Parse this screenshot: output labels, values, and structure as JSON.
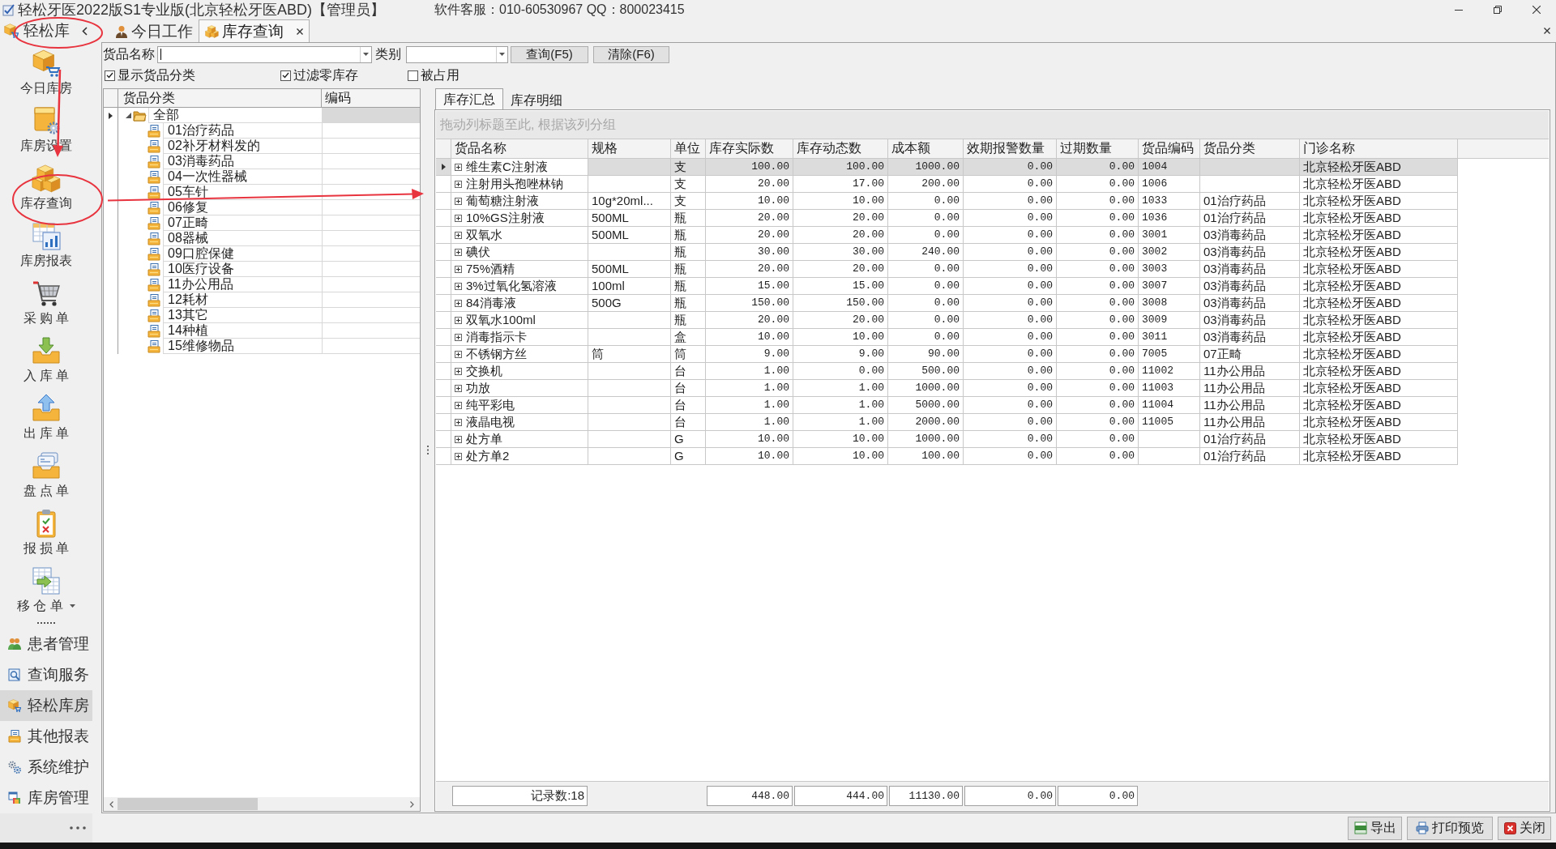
{
  "window": {
    "title": "轻松牙医2022版S1专业版(北京轻松牙医ABD)【管理员】",
    "support": "软件客服：010-60530967 QQ：800023415"
  },
  "sidebar": {
    "title": "轻松库",
    "tools": [
      {
        "label": "今日库房",
        "has_menu": false
      },
      {
        "label": "库房设置",
        "has_menu": false
      },
      {
        "label": "库存查询",
        "has_menu": false
      },
      {
        "label": "库房报表",
        "has_menu": false
      },
      {
        "label": "采 购 单",
        "has_menu": false
      },
      {
        "label": "入 库 单",
        "has_menu": false
      },
      {
        "label": "出 库 单",
        "has_menu": false
      },
      {
        "label": "盘 点 单",
        "has_menu": false
      },
      {
        "label": "报 损 单",
        "has_menu": false
      },
      {
        "label": "移 仓 单",
        "has_menu": true
      }
    ],
    "nav": [
      {
        "label": "患者管理",
        "selected": false
      },
      {
        "label": "查询服务",
        "selected": false
      },
      {
        "label": "轻松库房",
        "selected": true
      },
      {
        "label": "其他报表",
        "selected": false
      },
      {
        "label": "系统维护",
        "selected": false
      },
      {
        "label": "库房管理",
        "selected": false
      }
    ]
  },
  "tabs": [
    {
      "label": "今日工作",
      "selected": false,
      "closable": false
    },
    {
      "label": "库存查询",
      "selected": true,
      "closable": true
    }
  ],
  "filter": {
    "name_label": "货品名称",
    "category_label": "类别",
    "buttons": [
      "查询(F5)",
      "清除(F6)"
    ],
    "options": [
      {
        "label": "显示货品分类",
        "checked": true
      },
      {
        "label": "过滤零库存",
        "checked": true
      },
      {
        "label": "被占用",
        "checked": false
      }
    ]
  },
  "category_tree": {
    "columns": [
      "货品分类",
      "编码"
    ],
    "items": [
      {
        "label": "全部",
        "selected": true,
        "expanded": true,
        "children": [
          {
            "label": "01治疗药品",
            "selected": false
          },
          {
            "label": "02补牙材料发的",
            "selected": false
          },
          {
            "label": "03消毒药品",
            "selected": false
          },
          {
            "label": "04一次性器械",
            "selected": false
          },
          {
            "label": "05车针",
            "selected": false
          },
          {
            "label": "06修复",
            "selected": false
          },
          {
            "label": "07正畸",
            "selected": false
          },
          {
            "label": "08器械",
            "selected": false
          },
          {
            "label": "09口腔保健",
            "selected": false
          },
          {
            "label": "10医疗设备",
            "selected": false
          },
          {
            "label": "11办公用品",
            "selected": false
          },
          {
            "label": "12耗材",
            "selected": false
          },
          {
            "label": "13其它",
            "selected": false
          },
          {
            "label": "14种植",
            "selected": false
          },
          {
            "label": "15维修物品",
            "selected": false
          }
        ]
      }
    ]
  },
  "inventory": {
    "tabs": [
      {
        "label": "库存汇总",
        "selected": true
      },
      {
        "label": "库存明细",
        "selected": false
      }
    ],
    "group_hint": "拖动列标题至此, 根据该列分组",
    "columns": [
      {
        "label": "货品名称",
        "kind": "text"
      },
      {
        "label": "规格",
        "kind": "text"
      },
      {
        "label": "单位",
        "kind": "text"
      },
      {
        "label": "库存实际数",
        "kind": "number"
      },
      {
        "label": "库存动态数",
        "kind": "number"
      },
      {
        "label": "成本额",
        "kind": "number"
      },
      {
        "label": "效期报警数量",
        "kind": "number"
      },
      {
        "label": "过期数量",
        "kind": "number"
      },
      {
        "label": "货品编码",
        "kind": "code"
      },
      {
        "label": "货品分类",
        "kind": "text"
      },
      {
        "label": "门诊名称",
        "kind": "text"
      }
    ],
    "rows": [
      {
        "selected": true,
        "expanded": false,
        "cells": [
          "维生素C注射液",
          null,
          "支",
          "100.00",
          "100.00",
          "1000.00",
          "0.00",
          "0.00",
          "1004",
          null,
          "北京轻松牙医ABD"
        ]
      },
      {
        "selected": false,
        "expanded": false,
        "cells": [
          "注射用头孢唑林钠",
          null,
          "支",
          "20.00",
          "17.00",
          "200.00",
          "0.00",
          "0.00",
          "1006",
          null,
          "北京轻松牙医ABD"
        ]
      },
      {
        "selected": false,
        "expanded": false,
        "cells": [
          "葡萄糖注射液",
          "10g*20ml...",
          "支",
          "10.00",
          "10.00",
          "0.00",
          "0.00",
          "0.00",
          "1033",
          "01治疗药品",
          "北京轻松牙医ABD"
        ]
      },
      {
        "selected": false,
        "expanded": false,
        "cells": [
          "10%GS注射液",
          "500ML",
          "瓶",
          "20.00",
          "20.00",
          "0.00",
          "0.00",
          "0.00",
          "1036",
          "01治疗药品",
          "北京轻松牙医ABD"
        ]
      },
      {
        "selected": false,
        "expanded": false,
        "cells": [
          "双氧水",
          "500ML",
          "瓶",
          "20.00",
          "20.00",
          "0.00",
          "0.00",
          "0.00",
          "3001",
          "03消毒药品",
          "北京轻松牙医ABD"
        ]
      },
      {
        "selected": false,
        "expanded": false,
        "cells": [
          "碘伏",
          null,
          "瓶",
          "30.00",
          "30.00",
          "240.00",
          "0.00",
          "0.00",
          "3002",
          "03消毒药品",
          "北京轻松牙医ABD"
        ]
      },
      {
        "selected": false,
        "expanded": false,
        "cells": [
          "75%酒精",
          "500ML",
          "瓶",
          "20.00",
          "20.00",
          "0.00",
          "0.00",
          "0.00",
          "3003",
          "03消毒药品",
          "北京轻松牙医ABD"
        ]
      },
      {
        "selected": false,
        "expanded": false,
        "cells": [
          "3%过氧化氢溶液",
          "100ml",
          "瓶",
          "15.00",
          "15.00",
          "0.00",
          "0.00",
          "0.00",
          "3007",
          "03消毒药品",
          "北京轻松牙医ABD"
        ]
      },
      {
        "selected": false,
        "expanded": false,
        "cells": [
          "84消毒液",
          "500G",
          "瓶",
          "150.00",
          "150.00",
          "0.00",
          "0.00",
          "0.00",
          "3008",
          "03消毒药品",
          "北京轻松牙医ABD"
        ]
      },
      {
        "selected": false,
        "expanded": false,
        "cells": [
          "双氧水100ml",
          null,
          "瓶",
          "20.00",
          "20.00",
          "0.00",
          "0.00",
          "0.00",
          "3009",
          "03消毒药品",
          "北京轻松牙医ABD"
        ]
      },
      {
        "selected": false,
        "expanded": false,
        "cells": [
          "消毒指示卡",
          null,
          "盒",
          "10.00",
          "10.00",
          "0.00",
          "0.00",
          "0.00",
          "3011",
          "03消毒药品",
          "北京轻松牙医ABD"
        ]
      },
      {
        "selected": false,
        "expanded": false,
        "cells": [
          "不锈钢方丝",
          "筒",
          "筒",
          "9.00",
          "9.00",
          "90.00",
          "0.00",
          "0.00",
          "7005",
          "07正畸",
          "北京轻松牙医ABD"
        ]
      },
      {
        "selected": false,
        "expanded": false,
        "cells": [
          "交换机",
          null,
          "台",
          "1.00",
          "0.00",
          "500.00",
          "0.00",
          "0.00",
          "11002",
          "11办公用品",
          "北京轻松牙医ABD"
        ]
      },
      {
        "selected": false,
        "expanded": false,
        "cells": [
          "功放",
          null,
          "台",
          "1.00",
          "1.00",
          "1000.00",
          "0.00",
          "0.00",
          "11003",
          "11办公用品",
          "北京轻松牙医ABD"
        ]
      },
      {
        "selected": false,
        "expanded": false,
        "cells": [
          "纯平彩电",
          null,
          "台",
          "1.00",
          "1.00",
          "5000.00",
          "0.00",
          "0.00",
          "11004",
          "11办公用品",
          "北京轻松牙医ABD"
        ]
      },
      {
        "selected": false,
        "expanded": false,
        "cells": [
          "液晶电视",
          null,
          "台",
          "1.00",
          "1.00",
          "2000.00",
          "0.00",
          "0.00",
          "11005",
          "11办公用品",
          "北京轻松牙医ABD"
        ]
      },
      {
        "selected": false,
        "expanded": false,
        "cells": [
          "处方单",
          null,
          "G",
          "10.00",
          "10.00",
          "1000.00",
          "0.00",
          "0.00",
          null,
          "01治疗药品",
          "北京轻松牙医ABD"
        ]
      },
      {
        "selected": false,
        "expanded": false,
        "cells": [
          "处方单2",
          null,
          "G",
          "10.00",
          "10.00",
          "100.00",
          "0.00",
          "0.00",
          null,
          "01治疗药品",
          "北京轻松牙医ABD"
        ]
      }
    ],
    "summary": {
      "record_count": "记录数:18",
      "totals": [
        "448.00",
        "444.00",
        "11130.00",
        "0.00",
        "0.00"
      ]
    }
  },
  "actions": [
    {
      "label": "导出",
      "kind": "export"
    },
    {
      "label": "打印预览",
      "kind": "print"
    },
    {
      "label": "关闭",
      "kind": "close"
    }
  ]
}
